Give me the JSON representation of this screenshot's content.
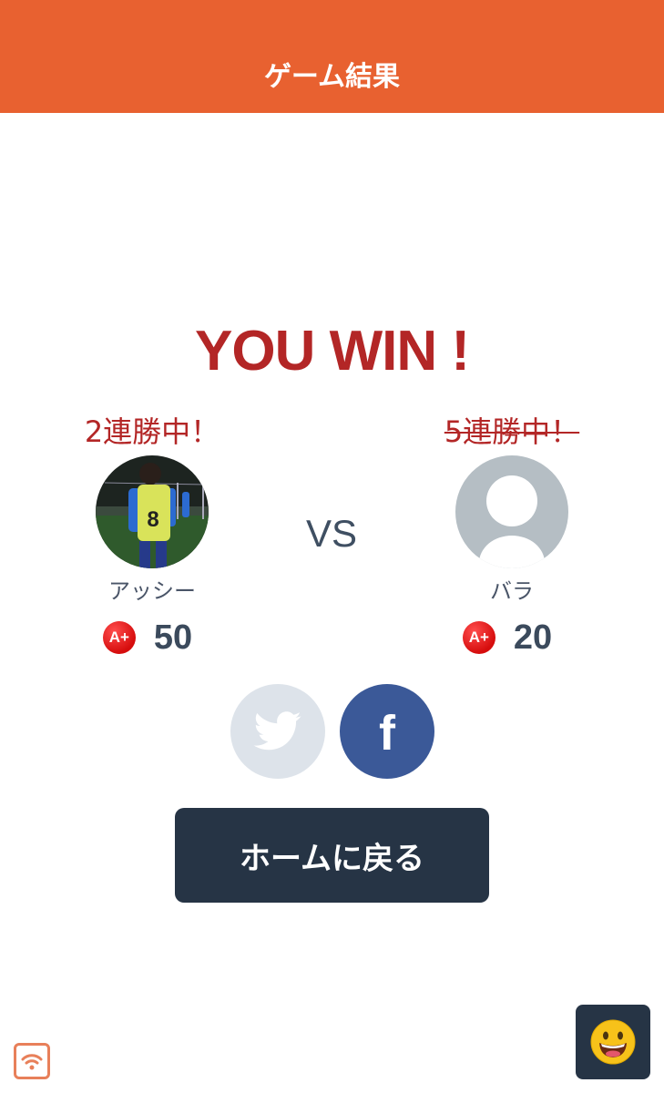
{
  "header": {
    "title": "ゲーム結果"
  },
  "result": {
    "text": "YOU WIN !"
  },
  "vs_label": "VS",
  "players": [
    {
      "streak": "2連勝中！",
      "streak_struck": false,
      "name": "アッシー",
      "rank": "A+",
      "score": "50"
    },
    {
      "streak": "5連勝中！",
      "streak_struck": true,
      "name": "バラ",
      "rank": "A+",
      "score": "20"
    }
  ],
  "share": {
    "twitter_icon": "twitter-bird-icon",
    "facebook_label": "f"
  },
  "home_button": {
    "label": "ホームに戻る"
  },
  "icons": {
    "wifi": "wifi-icon",
    "chat": "grinning-face-icon"
  },
  "colors": {
    "header": "#e86130",
    "win_text": "#b32626",
    "button": "#263445",
    "facebook": "#3b5998",
    "twitter_disabled": "#dde3ea"
  }
}
